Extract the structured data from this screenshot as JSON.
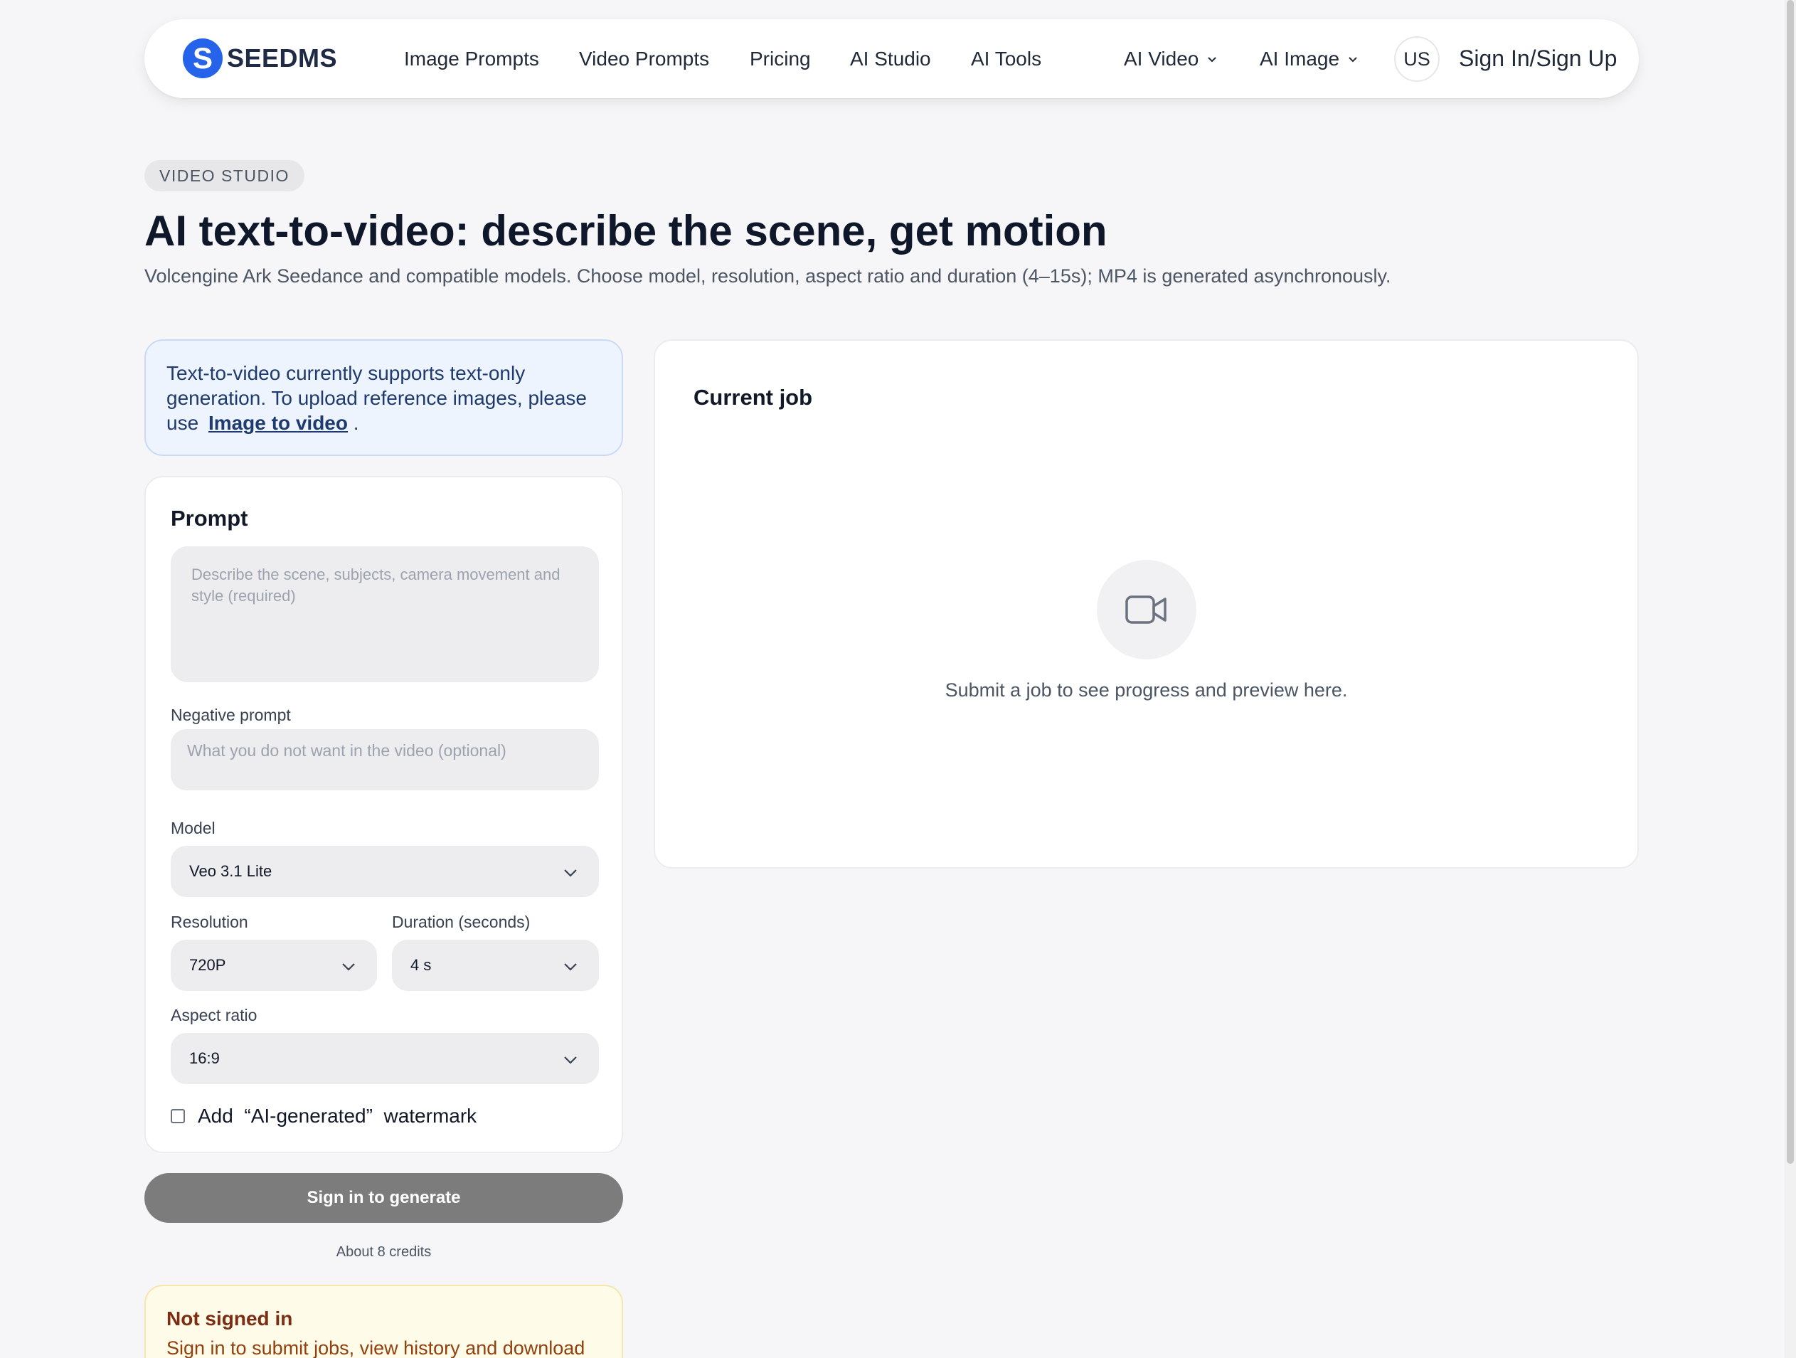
{
  "nav": {
    "logo_letter": "S",
    "logo_text": "SEEDMS",
    "links": [
      "Image Prompts",
      "Video Prompts",
      "Pricing",
      "AI Studio",
      "AI Tools"
    ],
    "ai_video": "AI Video",
    "ai_image": "AI Image",
    "lang": "US",
    "signin": "Sign In/Sign Up"
  },
  "header": {
    "badge": "VIDEO STUDIO",
    "title": "AI text-to-video: describe the scene, get motion",
    "subtitle": "Volcengine Ark Seedance and compatible models. Choose model, resolution, aspect ratio and duration (4–15s); MP4 is generated asynchronously."
  },
  "info": {
    "text": "Text-to-video currently supports text-only generation. To upload reference images, please use",
    "link": "Image to video",
    "suffix": "."
  },
  "form": {
    "prompt_title": "Prompt",
    "prompt_placeholder": "Describe the scene, subjects, camera movement and style (required)",
    "negative_label": "Negative prompt",
    "negative_placeholder": "What you do not want in the video (optional)",
    "model_label": "Model",
    "model_value": "Veo 3.1 Lite",
    "resolution_label": "Resolution",
    "resolution_value": "720P",
    "duration_label": "Duration (seconds)",
    "duration_value": "4 s",
    "aspect_label": "Aspect ratio",
    "aspect_value": "16:9",
    "watermark_label": "Add  “AI-generated”  watermark",
    "watermark_checked": false
  },
  "submit": {
    "label": "Sign in to generate",
    "credits": "About 8 credits"
  },
  "warning": {
    "title": "Not signed in",
    "text": "Sign in to submit jobs, view history and download"
  },
  "job": {
    "title": "Current job",
    "empty_text": "Submit a job to see progress and preview here.",
    "icon": "video-camera-icon"
  },
  "colors": {
    "brand": "#2563eb",
    "info_bg": "#eef4fd",
    "warn_bg": "#fefbe8",
    "button_disabled": "#7c7c7c"
  }
}
